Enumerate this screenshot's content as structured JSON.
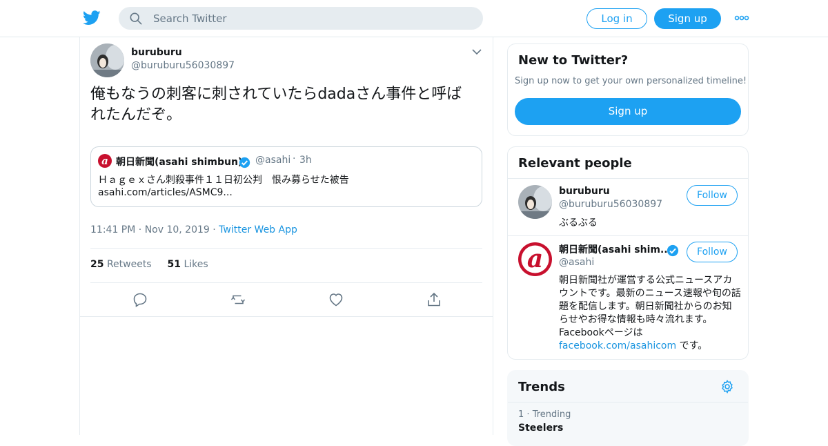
{
  "header": {
    "search_placeholder": "Search Twitter",
    "login_label": "Log in",
    "signup_label": "Sign up"
  },
  "tweet": {
    "author_name": "buruburu",
    "author_handle": "@buruburu56030897",
    "text": "俺もなうの刺客に刺されていたらdadaさん事件と呼ばれたんだぞ。",
    "quote": {
      "name": "朝日新聞(asahi shimbun)",
      "handle": "@asahi",
      "sep": "·",
      "time": "3h",
      "text": "Ｈａｇｅｘさん刺殺事件１１日初公判　恨み募らせた被告",
      "link": "asahi.com/articles/ASMC9..."
    },
    "time": "11:41 PM",
    "date": "Nov 10, 2019",
    "source": "Twitter Web App",
    "dot": "·",
    "retweets_count": "25",
    "retweets_label": "Retweets",
    "likes_count": "51",
    "likes_label": "Likes"
  },
  "new_to_twitter": {
    "title": "New to Twitter?",
    "subtitle": "Sign up now to get your own personalized timeline!",
    "signup_label": "Sign up"
  },
  "relevant_people": {
    "title": "Relevant people",
    "people": [
      {
        "name": "buruburu",
        "handle": "@buruburu56030897",
        "bio": "ぶるぶる",
        "follow_label": "Follow"
      },
      {
        "name": "朝日新聞(asahi shim...",
        "handle": "@asahi",
        "bio": "朝日新聞社が運営する公式ニュースアカウントです。最新のニュース速報や旬の話題を配信します。朝日新聞社からのお知らせやお得な情報も時々流れます。Facebookページは",
        "bio_link": "facebook.com/asahicom",
        "bio_end": " です。",
        "follow_label": "Follow"
      }
    ]
  },
  "trends": {
    "title": "Trends",
    "items": [
      {
        "rank": "1",
        "dot": "·",
        "label": "Trending",
        "name": "Steelers"
      }
    ]
  },
  "colors": {
    "accent": "#1da1f2",
    "text_secondary": "#657786",
    "border": "#e6ecf0",
    "asahi_red": "#c8102e"
  }
}
